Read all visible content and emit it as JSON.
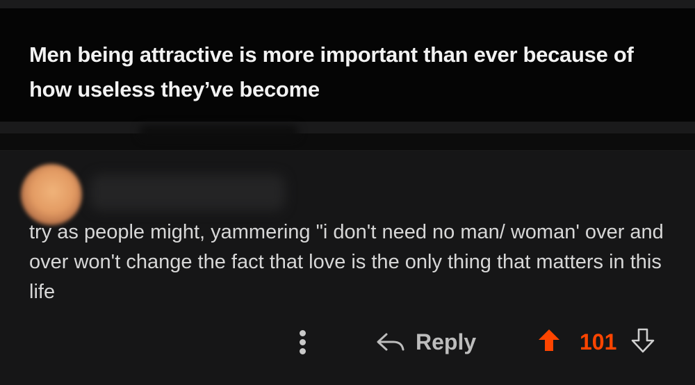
{
  "post": {
    "title": "Men being attractive is more important than ever because of how useless they’ve become"
  },
  "comment": {
    "body": "try as people might, yammering \"i don't need no man/ woman' over and over won't change the fact that love is the only thing that matters in this life",
    "actions": {
      "more_icon": "more-vertical-icon",
      "reply_icon": "reply-arrow-icon",
      "reply_label": "Reply",
      "upvote_icon": "upvote-arrow-icon",
      "downvote_icon": "downvote-arrow-icon",
      "vote_count": "101"
    }
  },
  "colors": {
    "upvote_active": "#ff4500",
    "header_bg": "#050505",
    "comment_bg": "#161617",
    "text_primary": "#f2f2f2",
    "text_secondary": "#d7d7d7"
  }
}
